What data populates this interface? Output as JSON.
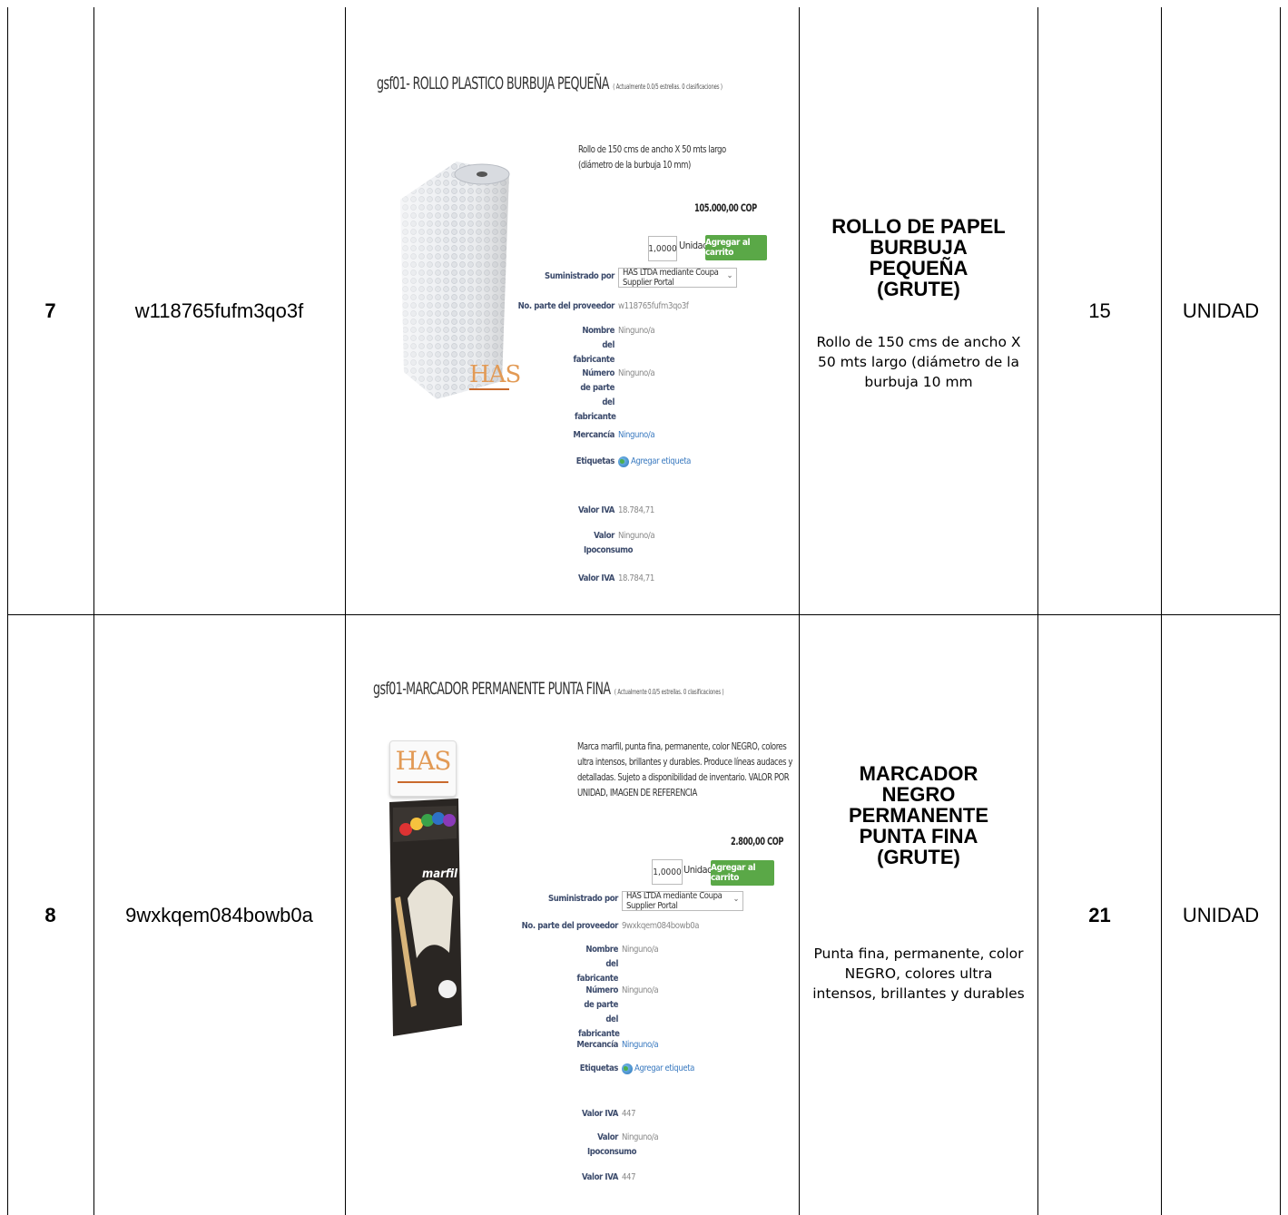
{
  "rows": [
    {
      "number": "7",
      "code": "w118765fufm3qo3f",
      "quantity": "15",
      "unit": "UNIDAD",
      "description_title": "ROLLO DE PAPEL BURBUJA PEQUEÑA (GRUTE)",
      "description_body": "Rollo de 150 cms de ancho X 50 mts largo (diámetro de la burbuja 10 mm",
      "screenshot": {
        "title": "gsf01- ROLLO PLASTICO BURBUJA PEQUEÑA",
        "rating": "( Actualmente 0.0/5 estrellas. 0 clasificaciones )",
        "summary": "Rollo de 150 cms de ancho X 50 mts largo (diámetro de la burbuja 10 mm)",
        "price": "105.000,00 COP",
        "qty_value": "1,0000",
        "qty_unit": "Unidad",
        "cart_button": "Agregar al carrito",
        "supplied_by_label": "Suministrado por",
        "supplier": "HAS LTDA mediante Coupa Supplier Portal",
        "part_label": "No. parte del proveedor",
        "part_value": "w118765fufm3qo3f",
        "maker_label": "Nombre del fabricante",
        "maker_value": "Ninguno/a",
        "maker_part_label": "Número de parte del fabricante",
        "maker_part_value": "Ninguno/a",
        "commodity_label": "Mercancía",
        "commodity_value": "Ninguno/a",
        "tags_label": "Etiquetas",
        "tags_value": "Agregar etiqueta",
        "iva_label": "Valor IVA",
        "iva_value": "18.784,71",
        "ipo_label": "Valor Ipoconsumo",
        "ipo_value": "Ninguno/a",
        "iva2_label": "Valor IVA",
        "iva2_value": "18.784,71"
      }
    },
    {
      "number": "8",
      "code": "9wxkqem084bowb0a",
      "quantity": "21",
      "unit": "UNIDAD",
      "description_title": "MARCADOR NEGRO PERMANENTE PUNTA FINA (GRUTE)",
      "description_body": "Punta fina, permanente, color NEGRO, colores ultra intensos, brillantes y durables",
      "screenshot": {
        "title": "gsf01-MARCADOR PERMANENTE PUNTA FINA",
        "rating": "( Actualmente 0.0/5 estrellas. 0 clasificaciones )",
        "summary": "Marca marfil, punta fina, permanente, color NEGRO, colores ultra intensos, brillantes y durables. Produce líneas audaces y detalladas. Sujeto a disponibilidad de inventario. VALOR POR UNIDAD, IMAGEN DE REFERENCIA",
        "price": "2.800,00 COP",
        "qty_value": "1,0000",
        "qty_unit": "Unidad",
        "cart_button": "Agregar al carrito",
        "supplied_by_label": "Suministrado por",
        "supplier": "HAS LTDA mediante Coupa Supplier Portal",
        "part_label": "No. parte del proveedor",
        "part_value": "9wxkqem084bowb0a",
        "maker_label": "Nombre del fabricante",
        "maker_value": "Ninguno/a",
        "maker_part_label": "Número de parte del fabricante",
        "maker_part_value": "Ninguno/a",
        "commodity_label": "Mercancía",
        "commodity_value": "Ninguno/a",
        "tags_label": "Etiquetas",
        "tags_value": "Agregar etiqueta",
        "iva_label": "Valor IVA",
        "iva_value": "447",
        "ipo_label": "Valor Ipoconsumo",
        "ipo_value": "Ninguno/a",
        "iva2_label": "Valor IVA",
        "iva2_value": "447"
      }
    }
  ],
  "logo_text": "HAS",
  "marker_brand": "marfil",
  "colors": {
    "border": "#000000",
    "cart_button": "#5aa847",
    "link": "#3a7ac0",
    "label": "#3b4a6b"
  }
}
